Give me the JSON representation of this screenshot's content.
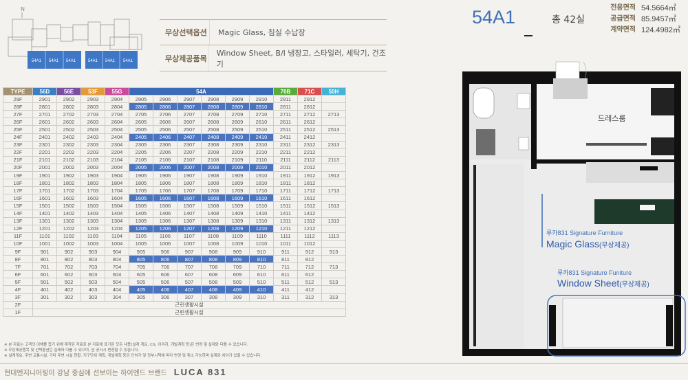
{
  "keyplan": {
    "north": "N",
    "units": [
      "54A1",
      "54A1",
      "54A1",
      "54A1",
      "54A1",
      "54A1"
    ]
  },
  "options": [
    {
      "label": "무상선택옵션",
      "value": "Magic Glass, 침실 수납장"
    },
    {
      "label": "무상제공품목",
      "value": "Window Sheet, B/I 냉장고, 스타일러, 세탁기, 건조기"
    }
  ],
  "unit_name": "54A1",
  "total": "총 42실",
  "areas": [
    {
      "label": "전용면적",
      "value": "54.5664㎡"
    },
    {
      "label": "공급면적",
      "value": "85.9457㎡"
    },
    {
      "label": "계약면적",
      "value": "124.4982㎡"
    }
  ],
  "plan": {
    "room_label": "드레스룸",
    "furn1_brand": "루카831 Signature Furniture",
    "furn1_name": "Magic Glass",
    "furn1_tag": "(무상제공)",
    "furn2_brand": "루카831 Signature Funiture",
    "furn2_name": "Window Sheet",
    "furn2_tag": "(무상제공)"
  },
  "table": {
    "headers": [
      {
        "label": "TYPE",
        "color": "#a39272"
      },
      {
        "label": "56D",
        "color": "#3b7ec4"
      },
      {
        "label": "56E",
        "color": "#7a4fa0"
      },
      {
        "label": "53F",
        "color": "#e39a3a"
      },
      {
        "label": "55G",
        "color": "#c94c9a"
      },
      {
        "label": "54A",
        "color": "#3b6ab8"
      },
      {
        "label": "70B",
        "color": "#5aab3c"
      },
      {
        "label": "71C",
        "color": "#d94f4f"
      },
      {
        "label": "50H",
        "color": "#46b3d6"
      }
    ],
    "highlight_floors": [
      "28F",
      "24F",
      "20F",
      "16F",
      "12F",
      "8F",
      "4F"
    ],
    "common_label": "근린생활시설",
    "rows": [
      [
        "29F",
        "2901",
        "2902",
        "2903",
        "2904",
        "2905",
        "2906",
        "2907",
        "2908",
        "2909",
        "2910",
        "2911",
        "2912",
        ""
      ],
      [
        "28F",
        "2801",
        "2802",
        "2803",
        "2804",
        "2805",
        "2806",
        "2807",
        "2808",
        "2809",
        "2810",
        "2811",
        "2812",
        ""
      ],
      [
        "27F",
        "2701",
        "2702",
        "2703",
        "2704",
        "2705",
        "2706",
        "2707",
        "2708",
        "2709",
        "2710",
        "2711",
        "2712",
        "2713"
      ],
      [
        "26F",
        "2601",
        "2602",
        "2603",
        "2604",
        "2605",
        "2606",
        "2607",
        "2608",
        "2609",
        "2610",
        "2611",
        "2612",
        ""
      ],
      [
        "25F",
        "2501",
        "2502",
        "2503",
        "2504",
        "2505",
        "2506",
        "2507",
        "2508",
        "2509",
        "2510",
        "2511",
        "2512",
        "2513"
      ],
      [
        "24F",
        "2401",
        "2402",
        "2403",
        "2404",
        "2405",
        "2406",
        "2407",
        "2408",
        "2409",
        "2410",
        "2411",
        "2412",
        ""
      ],
      [
        "23F",
        "2301",
        "2302",
        "2303",
        "2304",
        "2305",
        "2306",
        "2307",
        "2308",
        "2309",
        "2310",
        "2311",
        "2312",
        "2313"
      ],
      [
        "22F",
        "2201",
        "2202",
        "2203",
        "2204",
        "2205",
        "2206",
        "2207",
        "2208",
        "2209",
        "2210",
        "2211",
        "2212",
        ""
      ],
      [
        "21F",
        "2101",
        "2102",
        "2103",
        "2104",
        "2105",
        "2106",
        "2107",
        "2108",
        "2109",
        "2110",
        "2111",
        "2112",
        "2113"
      ],
      [
        "20F",
        "2001",
        "2002",
        "2003",
        "2004",
        "2005",
        "2006",
        "2007",
        "2008",
        "2009",
        "2010",
        "2011",
        "2012",
        ""
      ],
      [
        "19F",
        "1901",
        "1902",
        "1903",
        "1904",
        "1905",
        "1906",
        "1907",
        "1908",
        "1909",
        "1910",
        "1911",
        "1912",
        "1913"
      ],
      [
        "18F",
        "1801",
        "1802",
        "1803",
        "1804",
        "1805",
        "1806",
        "1807",
        "1808",
        "1809",
        "1810",
        "1811",
        "1812",
        ""
      ],
      [
        "17F",
        "1701",
        "1702",
        "1703",
        "1704",
        "1705",
        "1706",
        "1707",
        "1708",
        "1709",
        "1710",
        "1711",
        "1712",
        "1713"
      ],
      [
        "16F",
        "1601",
        "1602",
        "1603",
        "1604",
        "1605",
        "1606",
        "1607",
        "1608",
        "1609",
        "1610",
        "1611",
        "1612",
        ""
      ],
      [
        "15F",
        "1501",
        "1502",
        "1503",
        "1504",
        "1505",
        "1506",
        "1507",
        "1508",
        "1509",
        "1510",
        "1511",
        "1512",
        "1513"
      ],
      [
        "14F",
        "1401",
        "1402",
        "1403",
        "1404",
        "1405",
        "1406",
        "1407",
        "1408",
        "1409",
        "1410",
        "1411",
        "1412",
        ""
      ],
      [
        "13F",
        "1301",
        "1302",
        "1303",
        "1304",
        "1305",
        "1306",
        "1307",
        "1308",
        "1309",
        "1310",
        "1311",
        "1312",
        "1313"
      ],
      [
        "12F",
        "1201",
        "1202",
        "1203",
        "1204",
        "1205",
        "1206",
        "1207",
        "1208",
        "1209",
        "1210",
        "1211",
        "1212",
        ""
      ],
      [
        "11F",
        "1101",
        "1102",
        "1103",
        "1104",
        "1105",
        "1106",
        "1107",
        "1108",
        "1109",
        "1110",
        "1111",
        "1112",
        "1113"
      ],
      [
        "10F",
        "1001",
        "1002",
        "1003",
        "1004",
        "1005",
        "1006",
        "1007",
        "1008",
        "1009",
        "1010",
        "1011",
        "1012",
        ""
      ],
      [
        "9F",
        "901",
        "902",
        "903",
        "904",
        "905",
        "906",
        "907",
        "908",
        "909",
        "910",
        "911",
        "912",
        "913"
      ],
      [
        "8F",
        "801",
        "802",
        "803",
        "804",
        "805",
        "806",
        "807",
        "808",
        "809",
        "810",
        "811",
        "812",
        ""
      ],
      [
        "7F",
        "701",
        "702",
        "703",
        "704",
        "705",
        "706",
        "707",
        "708",
        "709",
        "710",
        "711",
        "712",
        "713"
      ],
      [
        "6F",
        "601",
        "602",
        "603",
        "604",
        "605",
        "606",
        "607",
        "608",
        "609",
        "610",
        "611",
        "612",
        ""
      ],
      [
        "5F",
        "501",
        "502",
        "503",
        "504",
        "505",
        "506",
        "507",
        "508",
        "509",
        "510",
        "511",
        "512",
        "513"
      ],
      [
        "4F",
        "401",
        "402",
        "403",
        "404",
        "405",
        "406",
        "407",
        "408",
        "409",
        "410",
        "411",
        "412",
        ""
      ],
      [
        "3F",
        "301",
        "302",
        "303",
        "304",
        "305",
        "306",
        "307",
        "308",
        "309",
        "310",
        "311",
        "312",
        "313"
      ]
    ],
    "common_floors": [
      "2F",
      "1F"
    ]
  },
  "notes": [
    "※ 본 자료는 고객의 이해를 돕기 위해 제작된 자료로 본 자료에 표기된 모든 내용(설계 개요, CG, 이미지, 개발계획 등)은 변경 및 실제와 다를 수 있습니다.",
    "※ 무상제공품목 및 선택옵션은 실제와 다를 수 있으며, 본 공사시 변경될 수 있습니다.",
    "※ 설계개요, 주변 교통시설, 기타 주변 시설 현황, 지구단위 계획, 개발계획 등은 인허가 및 정부시책에 따라 변경 및 취소 가능하며 실제와 차이가 있을 수 있습니다."
  ],
  "footer": {
    "text": "현대엔지니어링이 강남 중심에 선보이는 하이엔드 브랜드",
    "logo": "LUCA 831"
  }
}
